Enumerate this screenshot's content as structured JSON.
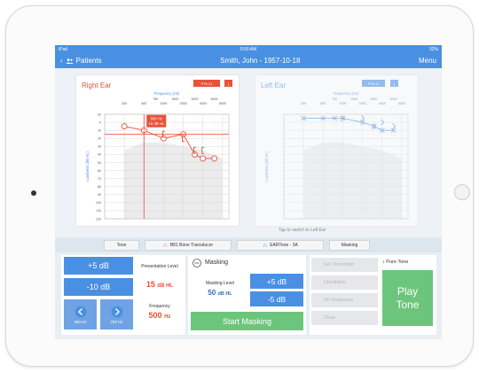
{
  "status_bar": {
    "carrier": "iPad",
    "time": "9:50 AM",
    "battery": "32%"
  },
  "nav": {
    "back_label": "Patients",
    "title": "Smith, John - 1957-10-18",
    "menu_label": "Menu"
  },
  "right_chart": {
    "title": "Right Ear",
    "freq_axis_label": "Frequency (Hz)",
    "freq_ticks_top": [
      "250",
      "500",
      "1000",
      "2000",
      "4000",
      "8000"
    ],
    "freq_ticks_bottom": [
      "750",
      "1500",
      "3000",
      "6000"
    ],
    "y_axis_label": "Loudness (dB HL)",
    "y_ticks": [
      "-10",
      "0",
      "10",
      "20",
      "30",
      "40",
      "50",
      "60",
      "70",
      "80",
      "90",
      "100",
      "110",
      "120"
    ],
    "pta_label": "PTA 21",
    "tooltip_line1": "500 Hz",
    "tooltip_line2": "15 dB HL",
    "colors": {
      "accent": "#e8513a"
    }
  },
  "left_chart": {
    "title": "Left Ear",
    "freq_axis_label": "Frequency (Hz)",
    "freq_ticks_top": [
      "250",
      "500",
      "1000",
      "2000",
      "4000",
      "8000"
    ],
    "freq_ticks_bottom": [
      "750",
      "1500",
      "3000",
      "6000"
    ],
    "y_axis_label": "Loudness (dB HL)",
    "pta_label": "PTA 11",
    "tap_hint": "Tap to switch to Left Ear",
    "colors": {
      "accent": "#4a90e2"
    }
  },
  "chart_data": [
    {
      "type": "line",
      "title": "Right Ear",
      "xlabel": "Frequency (Hz)",
      "ylabel": "Loudness (dB HL)",
      "x_scale": "log",
      "ylim": [
        -10,
        120
      ],
      "y_inverted": true,
      "series": [
        {
          "symbol": "O",
          "x": [
            250,
            500,
            1000,
            2000,
            3000,
            4000,
            6000
          ],
          "y": [
            5,
            10,
            20,
            15,
            40,
            45,
            45
          ]
        },
        {
          "symbol": "[",
          "x": [
            1000,
            2000,
            3000,
            4000
          ],
          "y": [
            15,
            20,
            35,
            35
          ]
        }
      ]
    },
    {
      "type": "line",
      "title": "Left Ear",
      "xlabel": "Frequency (Hz)",
      "ylabel": "Loudness (dB HL)",
      "x_scale": "log",
      "ylim": [
        -10,
        120
      ],
      "y_inverted": true,
      "series": [
        {
          "symbol": "X",
          "x": [
            250,
            500,
            750,
            1000,
            2000,
            3000,
            4000,
            6000
          ],
          "y": [
            -5,
            -5,
            -5,
            -5,
            0,
            5,
            10,
            10
          ]
        },
        {
          "symbol": ">",
          "x": [
            1000,
            2000,
            3000,
            4000,
            6000
          ],
          "y": [
            -5,
            -5,
            5,
            0,
            5
          ]
        }
      ]
    }
  ],
  "controls_bar": {
    "tone_label": "Tone",
    "transducer_label": "B81 Bone Transducer",
    "eartone_label": "EARTone - 3A",
    "masking_label": "Masking"
  },
  "presentation": {
    "plus_label": "+5 dB",
    "minus_label": "-10 dB",
    "level_caption": "Presentation Level",
    "level_value": "15",
    "level_unit": "dB HL",
    "freq_caption": "Frequency",
    "freq_value": "500",
    "freq_unit": "Hz",
    "prev_freq": "250 Hz",
    "next_freq": "750 Hz"
  },
  "masking": {
    "title": "Masking",
    "level_caption": "Masking Level",
    "level_value": "50",
    "level_unit": "dB HL",
    "plus_label": "+5 dB",
    "minus_label": "-5 dB",
    "start_label": "Start Masking"
  },
  "actions": {
    "set_threshold": "Set Threshold",
    "unreliable": "Unreliable",
    "no_response": "No Response",
    "clear": "Clear",
    "pure_tone_label": "Pure Tone",
    "play_line1": "Play",
    "play_line2": "Tone"
  }
}
